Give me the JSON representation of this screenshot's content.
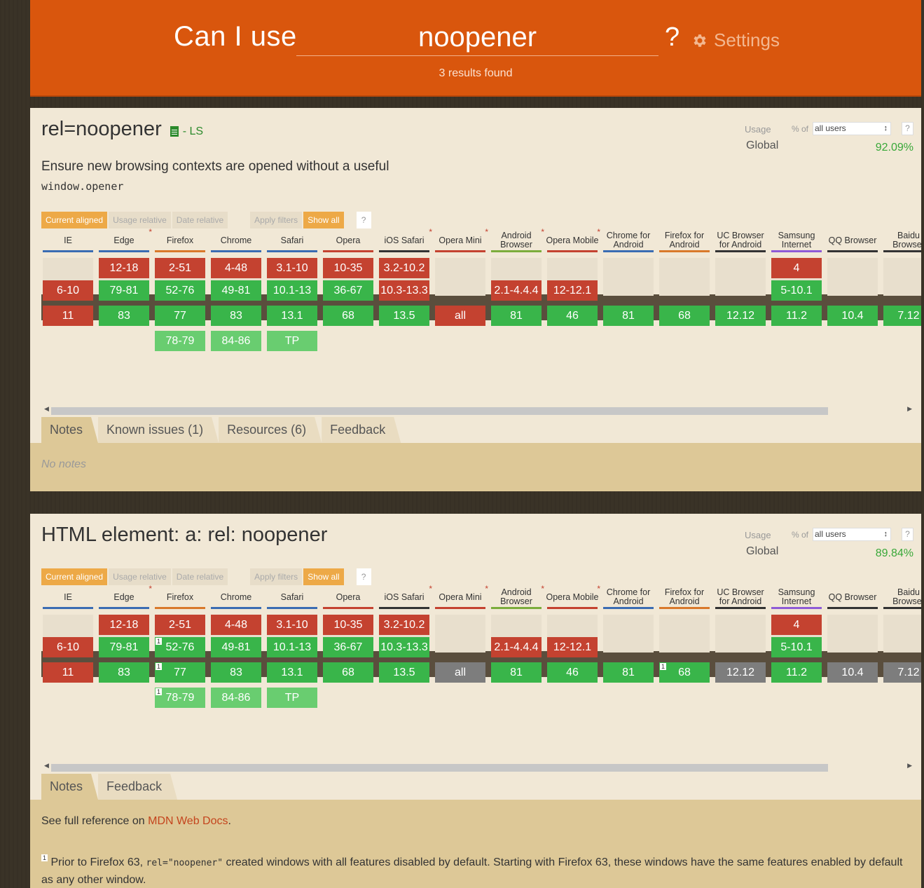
{
  "header": {
    "title": "Can I use",
    "search_value": "noopener",
    "help": "?",
    "settings_label": "Settings",
    "results": "3 results found",
    "colors": {
      "header_bg": "#d9560d"
    }
  },
  "browsers": [
    {
      "name": "IE",
      "asterisk": false,
      "color": "#3b6cb3"
    },
    {
      "name": "Edge",
      "asterisk": true,
      "color": "#3b6cb3"
    },
    {
      "name": "Firefox",
      "asterisk": false,
      "color": "#d9792b"
    },
    {
      "name": "Chrome",
      "asterisk": false,
      "color": "#3b6cb3"
    },
    {
      "name": "Safari",
      "asterisk": false,
      "color": "#3b6cb3"
    },
    {
      "name": "Opera",
      "asterisk": false,
      "color": "#c44230"
    },
    {
      "name": "iOS Safari",
      "asterisk": true,
      "color": "#333333"
    },
    {
      "name": "Opera Mini",
      "asterisk": true,
      "color": "#c44230"
    },
    {
      "name": "Android Browser",
      "asterisk": true,
      "color": "#7cac3c"
    },
    {
      "name": "Opera Mobile",
      "asterisk": true,
      "color": "#c44230"
    },
    {
      "name": "Chrome for Android",
      "asterisk": false,
      "color": "#3b6cb3"
    },
    {
      "name": "Firefox for Android",
      "asterisk": false,
      "color": "#d9792b"
    },
    {
      "name": "UC Browser for Android",
      "asterisk": false,
      "color": "#333333"
    },
    {
      "name": "Samsung Internet",
      "asterisk": false,
      "color": "#8e5bd6"
    },
    {
      "name": "QQ Browser",
      "asterisk": false,
      "color": "#333333"
    },
    {
      "name": "Baidu Browser",
      "asterisk": false,
      "color": "#333333"
    }
  ],
  "controls": [
    "Current aligned",
    "Usage relative",
    "Date relative",
    "Apply filters",
    "Show all",
    "?"
  ],
  "features": [
    {
      "title": "rel=noopener",
      "spec": "- LS",
      "description": "Ensure new browsing contexts are opened without a useful",
      "description_code": "window.opener",
      "usage_label": "Usage",
      "pct_of": "% of",
      "users": "all users",
      "help": "?",
      "global_label": "Global",
      "global_value": "92.09%",
      "rows": [
        [
          "",
          "12-18",
          "2-51",
          "4-48",
          "3.1-10",
          "10-35",
          "3.2-10.2",
          "",
          "",
          "",
          "",
          "",
          "",
          "4",
          "",
          ""
        ],
        [
          "6-10",
          "79-81",
          "52-76",
          "49-81",
          "10.1-13",
          "36-67",
          "10.3-13.3",
          "",
          "2.1-4.4.4",
          "12-12.1",
          "",
          "",
          "",
          "5-10.1",
          "",
          ""
        ],
        [
          "11",
          "83",
          "77",
          "83",
          "13.1",
          "68",
          "13.5",
          "all",
          "81",
          "46",
          "81",
          "68",
          "12.12",
          "11.2",
          "10.4",
          "7.12"
        ],
        [
          "",
          "",
          "78-79",
          "84-86",
          "TP",
          "",
          "",
          "",
          "",
          "",
          "",
          "",
          "",
          "",
          "",
          ""
        ]
      ],
      "tabs": [
        "Notes",
        "Known issues (1)",
        "Resources (6)",
        "Feedback"
      ],
      "notes_text": "No notes"
    },
    {
      "title": "HTML element: a: rel: noopener",
      "usage_label": "Usage",
      "pct_of": "% of",
      "users": "all users",
      "help": "?",
      "global_label": "Global",
      "global_value": "89.84%",
      "rows": [
        [
          "",
          "12-18",
          "2-51",
          "4-48",
          "3.1-10",
          "10-35",
          "3.2-10.2",
          "",
          "",
          "",
          "",
          "",
          "",
          "4",
          "",
          ""
        ],
        [
          "6-10",
          "79-81",
          "52-76",
          "49-81",
          "10.1-13",
          "36-67",
          "10.3-13.3",
          "",
          "2.1-4.4.4",
          "12-12.1",
          "",
          "",
          "",
          "5-10.1",
          "",
          ""
        ],
        [
          "11",
          "83",
          "77",
          "83",
          "13.1",
          "68",
          "13.5",
          "all",
          "81",
          "46",
          "81",
          "68",
          "12.12",
          "11.2",
          "10.4",
          "7.12"
        ],
        [
          "",
          "",
          "78-79",
          "84-86",
          "TP",
          "",
          "",
          "",
          "",
          "",
          "",
          "",
          "",
          "",
          "",
          ""
        ]
      ],
      "tabs": [
        "Notes",
        "Feedback"
      ],
      "notes_prefix": "See full reference on",
      "notes_link": "MDN Web Docs",
      "notes_suffix": ".",
      "footnote_num": "1",
      "footnote_a": "Prior to Firefox 63,",
      "footnote_code": "rel=\"noopener\"",
      "footnote_b": "created windows with all features disabled by default. Starting with Firefox 63, these windows have the same features enabled by",
      "footnote_c": "default as any other window."
    }
  ]
}
